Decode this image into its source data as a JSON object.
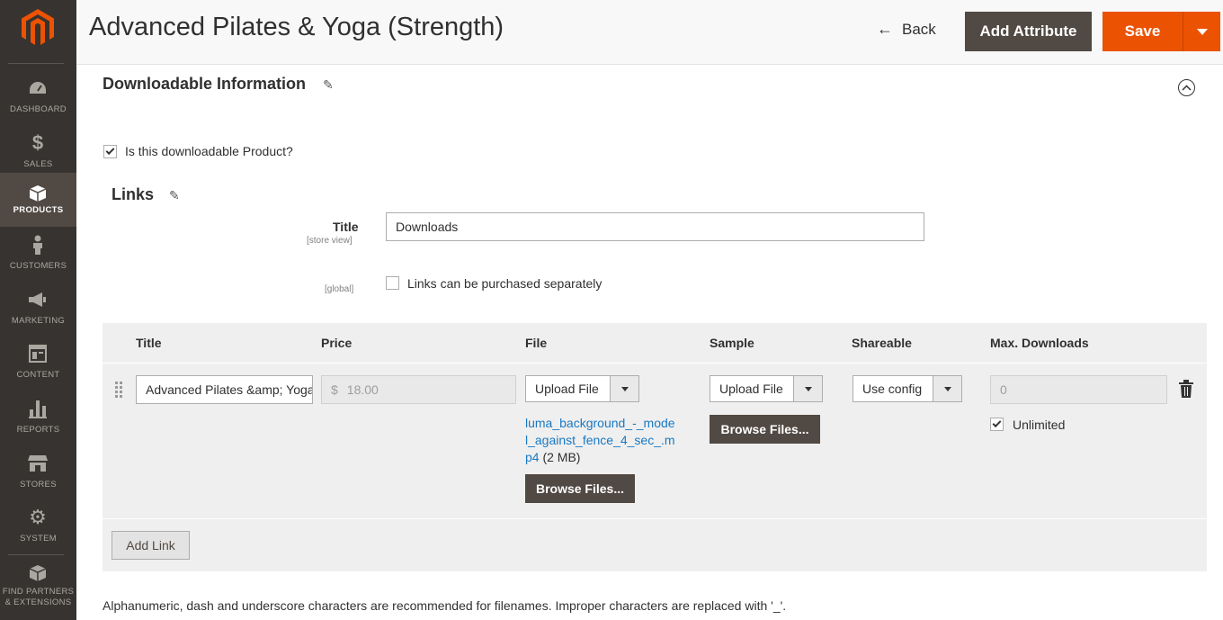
{
  "sidebar": {
    "items": [
      {
        "label": "Dashboard",
        "icon": "dashboard-icon"
      },
      {
        "label": "Sales",
        "icon": "dollar-icon"
      },
      {
        "label": "Products",
        "icon": "box-icon"
      },
      {
        "label": "Customers",
        "icon": "person-icon"
      },
      {
        "label": "Marketing",
        "icon": "megaphone-icon"
      },
      {
        "label": "Content",
        "icon": "content-icon"
      },
      {
        "label": "Reports",
        "icon": "bar-chart-icon"
      },
      {
        "label": "Stores",
        "icon": "store-icon"
      },
      {
        "label": "System",
        "icon": "gear-icon"
      },
      {
        "label": "Find Partners & Extensions",
        "icon": "extensions-icon"
      }
    ],
    "active": "Products"
  },
  "header": {
    "title": "Advanced Pilates & Yoga (Strength)",
    "back_label": "Back",
    "add_attribute_label": "Add Attribute",
    "save_label": "Save"
  },
  "section": {
    "title": "Downloadable Information",
    "is_downloadable_label": "Is this downloadable Product?",
    "is_downloadable_checked": true
  },
  "links": {
    "heading": "Links",
    "title_label": "Title",
    "title_scope": "[store view]",
    "title_value": "Downloads",
    "global_scope": "[global]",
    "purchased_separately_label": "Links can be purchased separately",
    "purchased_separately_checked": false,
    "table": {
      "columns": [
        "Title",
        "Price",
        "File",
        "Sample",
        "Shareable",
        "Max. Downloads"
      ],
      "rows": [
        {
          "title": "Advanced Pilates &amp; Yoga (Strength)",
          "price_symbol": "$",
          "price": "18.00",
          "file_type": "Upload File",
          "file_name": "luma_background_-_model_against_fence_4_sec_.mp4",
          "file_size": "(2 MB)",
          "file_browse_label": "Browse Files...",
          "sample_type": "Upload File",
          "sample_browse_label": "Browse Files...",
          "shareable": "Use config",
          "max_downloads": "0",
          "unlimited_label": "Unlimited",
          "unlimited_checked": true
        }
      ],
      "add_link_label": "Add Link"
    },
    "note": "Alphanumeric, dash and underscore characters are recommended for filenames. Improper characters are replaced with '_'."
  },
  "colors": {
    "sidebar_bg": "#373330",
    "sidebar_active": "#514943",
    "accent_orange": "#eb5202",
    "button_dark": "#514943",
    "link_blue": "#1979c3"
  }
}
